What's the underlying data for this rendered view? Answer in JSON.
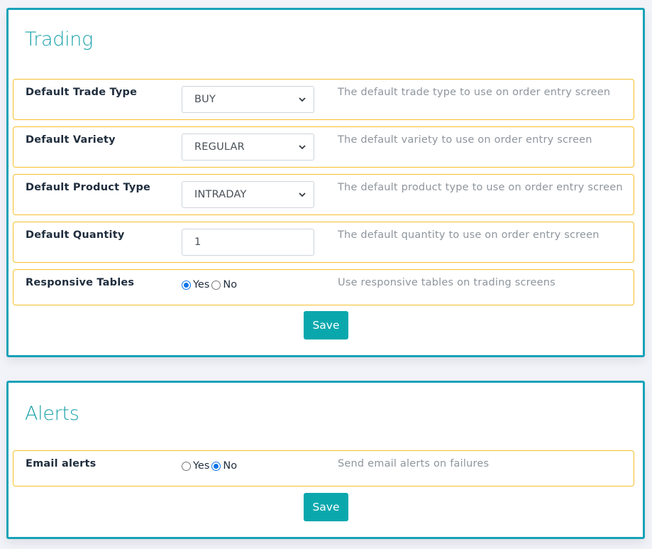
{
  "colors": {
    "accent": "#17a2b8",
    "title": "#1ba2aa",
    "row_border": "#f5c02c",
    "button": "#0aa8ad",
    "radio_checked": "#0b74e6",
    "description": "#8e959c"
  },
  "trading": {
    "title": "Trading",
    "rows": [
      {
        "label": "Default Trade Type",
        "type": "select",
        "value": "BUY",
        "description": "The default trade type to use on order entry screen"
      },
      {
        "label": "Default Variety",
        "type": "select",
        "value": "REGULAR",
        "description": "The default variety to use on order entry screen"
      },
      {
        "label": "Default Product Type",
        "type": "select",
        "value": "INTRADAY",
        "description": "The default product type to use on order entry screen"
      },
      {
        "label": "Default Quantity",
        "type": "input",
        "value": "1",
        "description": "The default quantity to use on order entry screen"
      },
      {
        "label": "Responsive Tables",
        "type": "radio",
        "options": [
          "Yes",
          "No"
        ],
        "selected": "Yes",
        "description": "Use responsive tables on trading screens"
      }
    ],
    "save_label": "Save"
  },
  "alerts": {
    "title": "Alerts",
    "rows": [
      {
        "label": "Email alerts",
        "type": "radio",
        "options": [
          "Yes",
          "No"
        ],
        "selected": "No",
        "description": "Send email alerts on failures"
      }
    ],
    "save_label": "Save"
  }
}
